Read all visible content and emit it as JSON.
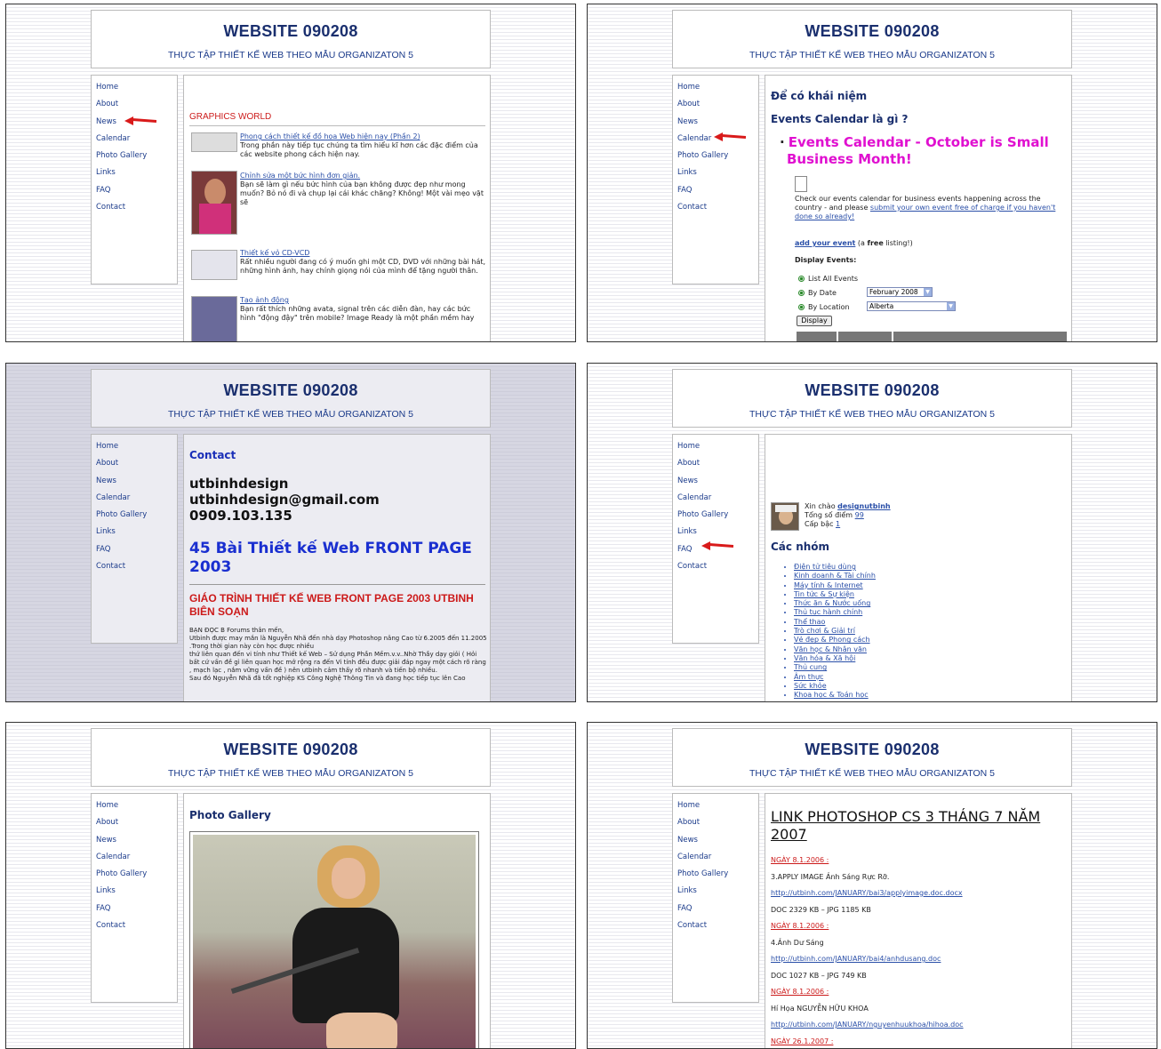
{
  "site": {
    "title": "WEBSITE 090208",
    "subtitle": "THỰC TẬP THIẾT KẾ WEB THEO MẪU ORGANIZATON 5"
  },
  "nav": [
    "Home",
    "About",
    "News",
    "Calendar",
    "Photo Gallery",
    "Links",
    "FAQ",
    "Contact"
  ],
  "colors": {
    "accent": "#1a2f6e",
    "red": "#cc1a1a",
    "magenta": "#e010d0",
    "arrow": "#d91a1a"
  },
  "news": {
    "heading": "GRAPHICS WORLD",
    "items": [
      {
        "title": "Phong cách thiết kế đồ họa Web hiện nay (Phần 2)",
        "text": "Trong phần này tiếp tục chúng ta tìm hiểu kĩ hơn các đặc điểm của các website phong cách hiện nay."
      },
      {
        "title": "Chỉnh sửa một bức hình đơn giản.",
        "text": "Bạn sẽ làm gì nếu bức hình của bạn không được đẹp như mong muốn? Bỏ nó đi và chụp lại cái khác chăng? Không! Một vài mẹo vặt sẽ"
      },
      {
        "title": "Thiết kế vỏ CD-VCD",
        "text": "Rất nhiều người đang có ý muốn ghi một CD, DVD với những bài hát, những hình ảnh, hay chính giọng nói của mình để tặng người thân."
      },
      {
        "title": "Tạo ảnh động",
        "text": "Bạn rất thích những avata, signal trên các diễn đàn, hay các bức hình \"động đậy\" trên mobile? Image Ready là một phần mềm hay"
      }
    ]
  },
  "calendar": {
    "q1": "Để có khái niệm",
    "q2": "Events Calendar là gì ?",
    "headline": "Events Calendar - October is Small Business Month!",
    "text": "Check our events calendar for business events happening across the country - and please",
    "link": "submit your own event free of charge if you haven't done so already!",
    "add_link": "add your event",
    "add_rest": "(a",
    "add_free": "free",
    "add_end": "listing!)",
    "display_label": "Display Events:",
    "options": [
      "List All Events",
      "By Date",
      "By Location"
    ],
    "date_value": "February 2008",
    "location_value": "Alberta",
    "button": "Display"
  },
  "contact": {
    "heading": "Contact",
    "name": "utbinhdesign",
    "email": "utbinhdesign@gmail.com",
    "phone": "0909.103.135",
    "big": "45 Bài Thiết kế Web FRONT PAGE 2003",
    "red": "GIÁO TRÌNH THIẾT KẾ WEB FRONT PAGE 2003 UTBINH BIÊN SOẠN",
    "body": "BẠN ĐỌC B Forums thân mến,\nUtbinh được may mắn là Nguyễn Nhã đến nhà dạy Photoshop nâng Cao từ 6.2005 đến 11.2005 .Trong thời gian này còn học được nhiều\nthứ liên quan đến vi tính như Thiết kế Web – Sử dụng Phần Mềm.v.v..Nhờ Thầy dạy giỏi ( Hỏi bất cứ vấn đề gì liên quan học mở rộng ra đến Vi tính đều được giải đáp ngay một cách rõ ràng , mạch lạc , nắm vững vấn đề ) nên utbinh cảm thấy rõ nhanh và tiến bộ nhiều.\nSau đó Nguyễn Nhã đã tốt nghiệp KS Công Nghệ Thông Tin và đang học tiếp tục lên Cao"
  },
  "faq": {
    "greeting": "Xin chào",
    "user": "designutbinh",
    "points_label": "Tổng số điểm",
    "points": "99",
    "level_label": "Cấp bậc",
    "level": "1",
    "groups_heading": "Các nhóm",
    "groups": [
      "Điện tử tiêu dùng",
      "Kinh doanh & Tài chính",
      "Máy tính & Internet",
      "Tin tức & Sự kiện",
      "Thức ăn & Nước uống",
      "Thủ tục hành chính",
      "Thể thao",
      "Trò chơi & Giải trí",
      "Vẻ đẹp & Phong cách",
      "Văn học & Nhân văn",
      "Văn hóa & Xã hội",
      "Thủ cung",
      "Âm thực",
      "Sức khỏe",
      "Khoa học & Toán học"
    ]
  },
  "gallery": {
    "heading": "Photo Gallery"
  },
  "links": {
    "title": "LINK PHOTOSHOP CS 3 THÁNG 7 NĂM 2007",
    "entries": [
      {
        "date": "NGÀY 8.1.2006 :",
        "desc": "3.APPLY IMAGE Ảnh Sáng Rực Rỡ.",
        "url": "http://utbinh.com/JANUARY/bai3/applyimage.doc.docx",
        "size": "DOC 2329 KB – JPG 1185 KB"
      },
      {
        "date": "NGÀY 8.1.2006 :",
        "desc": "4.Ảnh Dư Sáng",
        "url": "http://utbinh.com/JANUARY/bai4/anhdusang.doc",
        "size": "DOC 1027 KB – JPG 749 KB"
      },
      {
        "date": "NGÀY 8.1.2006 :",
        "desc": "Hí Họa NGUYỄN HỮU KHOA",
        "url": "http://utbinh.com/JANUARY/nguyenhuukhoa/hihoa.doc",
        "size": ""
      },
      {
        "date": "NGÀY 26.1.2007 :",
        "desc": "",
        "url": "",
        "size": ""
      }
    ]
  }
}
